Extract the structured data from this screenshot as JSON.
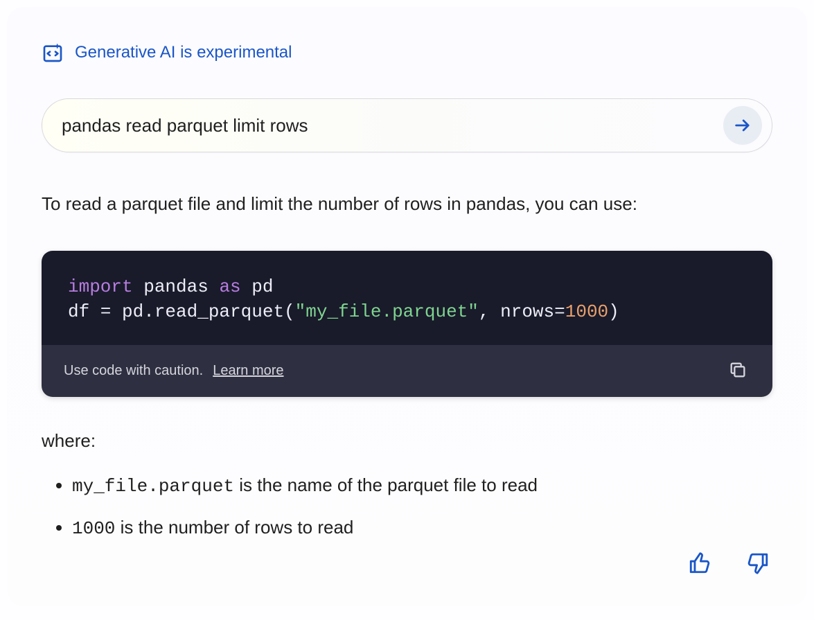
{
  "header": {
    "title": "Generative AI is experimental"
  },
  "search": {
    "value": "pandas read parquet limit rows"
  },
  "intro": "To read a parquet file and limit the number of rows in pandas, you can use:",
  "code": {
    "tokens": [
      {
        "t": "import",
        "c": "kw"
      },
      {
        "t": " pandas ",
        "c": "id"
      },
      {
        "t": "as",
        "c": "kw"
      },
      {
        "t": " pd",
        "c": "id"
      },
      {
        "t": "\n",
        "c": "id"
      },
      {
        "t": "df = pd.read_parquet(",
        "c": "id"
      },
      {
        "t": "\"my_file.parquet\"",
        "c": "str"
      },
      {
        "t": ", nrows=",
        "c": "id"
      },
      {
        "t": "1000",
        "c": "num"
      },
      {
        "t": ")",
        "c": "id"
      }
    ],
    "caution": "Use code with caution.",
    "learn": "Learn more"
  },
  "where": {
    "label": "where:",
    "items": [
      {
        "code": "my_file.parquet",
        "rest": " is the name of the parquet file to read"
      },
      {
        "code": "1000",
        "rest": " is the number of rows to read"
      }
    ]
  }
}
